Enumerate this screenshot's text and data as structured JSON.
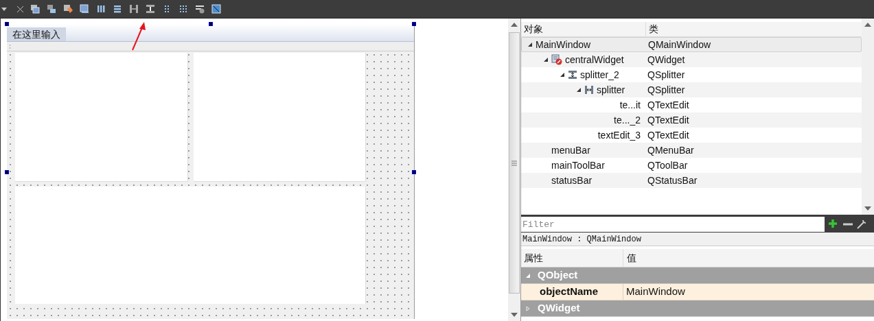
{
  "form": {
    "menu_bar": {
      "items": [
        {
          "label": "在这里输入"
        }
      ]
    }
  },
  "object_inspector": {
    "columns": [
      "对象",
      "类"
    ],
    "tree": [
      {
        "name": "MainWindow",
        "class": "QMainWindow",
        "selected": true,
        "expanded": true,
        "children": [
          {
            "name": "centralWidget",
            "class": "QWidget",
            "kind": "widget",
            "selected": false,
            "expanded": true,
            "children": [
              {
                "name": "splitter_2",
                "class": "QSplitter",
                "kind": "vsplitter",
                "selected": false,
                "expanded": true,
                "children": [
                  {
                    "name": "splitter",
                    "class": "QSplitter",
                    "kind": "hsplitter",
                    "selected": false,
                    "expanded": true,
                    "children": [
                      {
                        "name": "te...it",
                        "class": "QTextEdit",
                        "selected": false
                      },
                      {
                        "name": "te..._2",
                        "class": "QTextEdit",
                        "selected": false
                      }
                    ]
                  },
                  {
                    "name": "textEdit_3",
                    "class": "QTextEdit",
                    "selected": false
                  }
                ]
              }
            ]
          },
          {
            "name": "menuBar",
            "class": "QMenuBar",
            "selected": false
          },
          {
            "name": "mainToolBar",
            "class": "QToolBar",
            "selected": false
          },
          {
            "name": "statusBar",
            "class": "QStatusBar",
            "selected": false
          }
        ]
      }
    ]
  },
  "filter": {
    "placeholder": "Filter"
  },
  "current_object": "MainWindow : QMainWindow",
  "property_editor": {
    "columns": [
      "属性",
      "值"
    ],
    "groups": [
      {
        "name": "QObject",
        "expanded": true,
        "properties": [
          {
            "name": "objectName",
            "value": "MainWindow"
          }
        ]
      },
      {
        "name": "QWidget",
        "expanded": false
      }
    ]
  }
}
